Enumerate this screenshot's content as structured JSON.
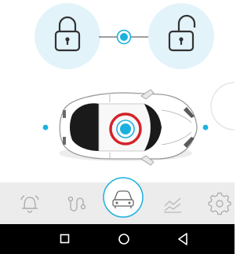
{
  "lock_control": {
    "lock_icon": "padlock-closed-icon",
    "unlock_icon": "padlock-open-icon",
    "slider_handle_icon": "slider-handle-icon"
  },
  "car": {
    "image_icon": "car-top-view-icon",
    "left_indicator_icon": "dot-icon",
    "right_indicator_icon": "dot-icon",
    "center_button_icon": "target-button-icon",
    "colors": {
      "accent": "#1bb1de",
      "highlight_ring": "#d4232a"
    }
  },
  "tab_bar": {
    "items": [
      {
        "icon": "alarm-bell-icon"
      },
      {
        "icon": "route-icon"
      },
      {
        "icon": "car-icon",
        "selected": true
      },
      {
        "icon": "chart-icon"
      },
      {
        "icon": "gear-icon"
      }
    ]
  },
  "system_nav": {
    "items": [
      {
        "icon": "recent-apps-square-icon"
      },
      {
        "icon": "home-circle-icon"
      },
      {
        "icon": "back-triangle-icon"
      }
    ]
  }
}
